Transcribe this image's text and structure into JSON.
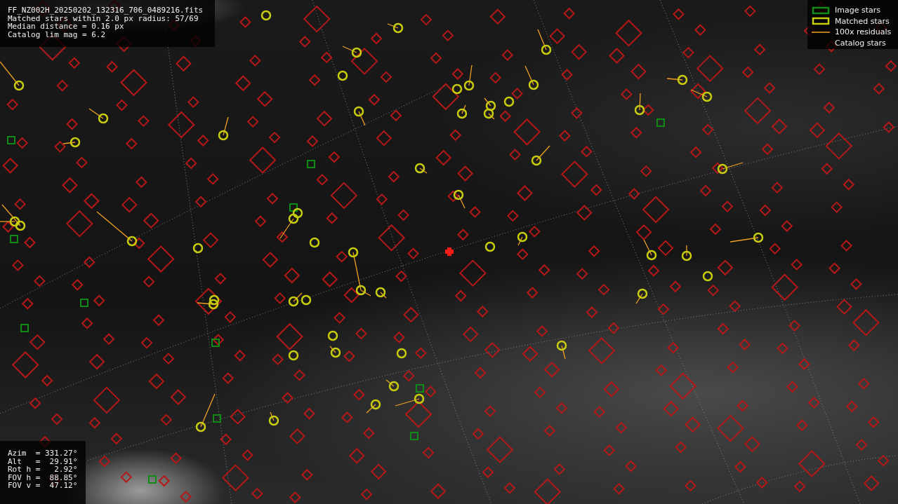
{
  "file_info": {
    "lines": [
      "FF_NZ002H_20250202_132316_706_0489216.fits",
      "Matched stars within 2.0 px radius: 57/69",
      "Median distance = 0.16 px",
      "Catalog lim mag = 6.2"
    ]
  },
  "legend": {
    "items": [
      {
        "kind": "image",
        "label": "Image stars"
      },
      {
        "kind": "matched",
        "label": "Matched stars"
      },
      {
        "kind": "residual",
        "label": "100x residuals"
      },
      {
        "kind": "catalog",
        "label": "Catalog stars"
      }
    ]
  },
  "pointing_info": {
    "lines": [
      "Azim  = 331.27°",
      "Alt   =  29.91°",
      "Rot h =   2.92°",
      "FOV h =  88.85°",
      "FOV v =  47.12°"
    ]
  }
}
